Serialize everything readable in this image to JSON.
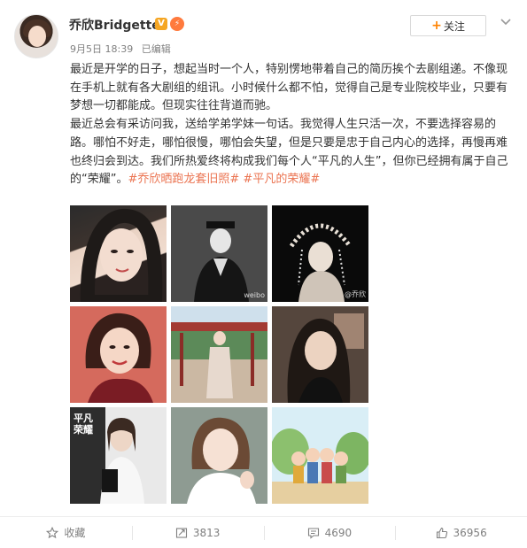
{
  "post": {
    "user_name": "乔欣Bridgette",
    "vip_badge": "V",
    "level_badge": "⚡",
    "date": "9月5日 18:39",
    "edited": "已编辑",
    "follow_label": "关注",
    "paragraph_1": "最近是开学的日子，想起当时一个人，特别愣地带着自己的简历挨个去剧组递。不像现在手机上就有各大剧组的组讯。小时候什么都不怕，觉得自己是专业院校毕业，只要有梦想一切都能成。但现实往往背道而驰。",
    "paragraph_2": "最近总会有采访问我，送给学弟学妹一句话。我觉得人生只活一次，不要选择容易的路。哪怕不好走，哪怕很慢，哪怕会失望，但是只要是忠于自己内心的选择，再慢再难也终归会到达。我们所热爱终将构成我们每个人“平凡的人生”，但你已经拥有属于自己的“荣耀”。",
    "hashtag_1": "#乔欣晒跑龙套旧照#",
    "hashtag_2": "#平凡的荣耀#",
    "photo_7_text": "平凡的\n荣耀",
    "photo_3_watermark": "@乔欣",
    "photo_2_watermark": "weibo"
  },
  "actions": {
    "favorite": "收藏",
    "repost": "3813",
    "comment": "4690",
    "like": "36956"
  },
  "colors": {
    "hashtag": "#eb7350",
    "follow_plus": "#ff8200",
    "vip": "#f5a623"
  },
  "icons": {
    "favorite": "star-icon",
    "repost": "repost-icon",
    "comment": "comment-icon",
    "like": "thumbs-up-icon",
    "more": "chevron-down-icon"
  }
}
